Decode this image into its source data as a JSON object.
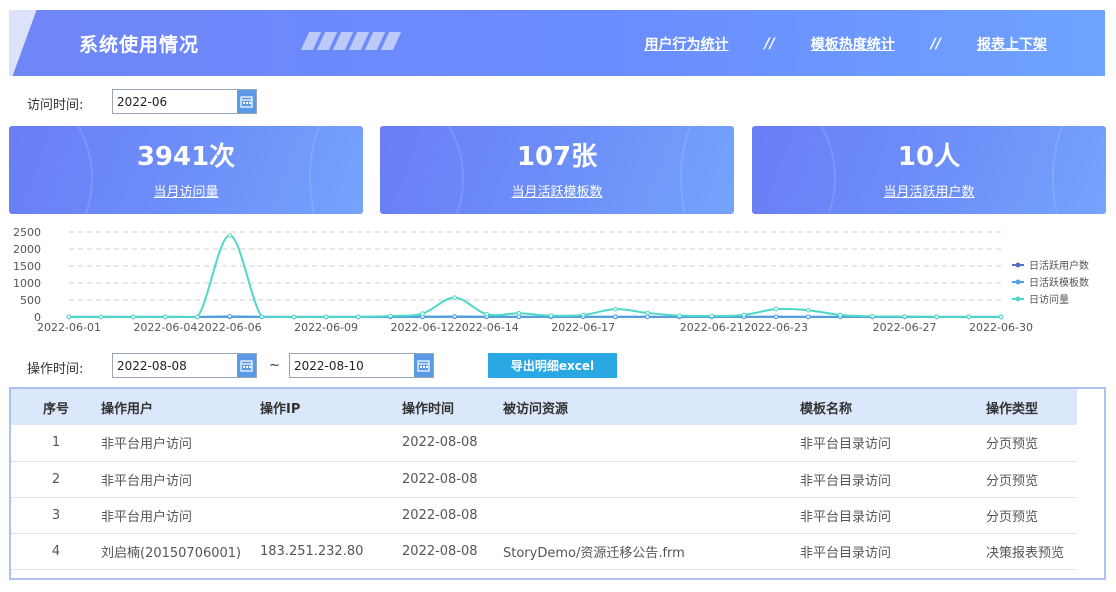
{
  "header": {
    "title": "系统使用情况",
    "nav": [
      {
        "label": "用户行为统计"
      },
      {
        "label": "模板热度统计"
      },
      {
        "label": "报表上下架"
      }
    ],
    "separator": "//"
  },
  "filter_visit": {
    "label": "访问时间:",
    "value": "2022-06"
  },
  "cards": [
    {
      "value": "3941次",
      "label": "当月访问量"
    },
    {
      "value": "107张",
      "label": "当月活跃模板数"
    },
    {
      "value": "10人",
      "label": "当月活跃用户数"
    }
  ],
  "chart_data": {
    "type": "line",
    "x": [
      "2022-06-01",
      "2022-06-02",
      "2022-06-03",
      "2022-06-04",
      "2022-06-05",
      "2022-06-06",
      "2022-06-07",
      "2022-06-08",
      "2022-06-09",
      "2022-06-10",
      "2022-06-11",
      "2022-06-12",
      "2022-06-13",
      "2022-06-14",
      "2022-06-15",
      "2022-06-16",
      "2022-06-17",
      "2022-06-18",
      "2022-06-19",
      "2022-06-20",
      "2022-06-21",
      "2022-06-22",
      "2022-06-23",
      "2022-06-24",
      "2022-06-25",
      "2022-06-26",
      "2022-06-27",
      "2022-06-28",
      "2022-06-29",
      "2022-06-30"
    ],
    "xticks": [
      "2022-06-01",
      "2022-06-04",
      "2022-06-06",
      "2022-06-09",
      "2022-06-12",
      "2022-06-14",
      "2022-06-17",
      "2022-06-21",
      "2022-06-23",
      "2022-06-27",
      "2022-06-30"
    ],
    "yticks": [
      0,
      500,
      1000,
      1500,
      2000,
      2500
    ],
    "ylim": [
      0,
      2500
    ],
    "grid": true,
    "legend_position": "right",
    "series": [
      {
        "name": "日活跃用户数",
        "color": "#5470c6",
        "values": [
          2,
          2,
          2,
          2,
          2,
          5,
          3,
          2,
          2,
          2,
          2,
          3,
          4,
          3,
          3,
          2,
          3,
          3,
          3,
          2,
          2,
          3,
          3,
          3,
          2,
          2,
          2,
          2,
          2,
          2
        ]
      },
      {
        "name": "日活跃模板数",
        "color": "#4ea0e2",
        "values": [
          1,
          1,
          1,
          1,
          1,
          20,
          4,
          1,
          1,
          1,
          5,
          10,
          15,
          10,
          6,
          4,
          6,
          8,
          6,
          4,
          3,
          5,
          8,
          6,
          3,
          2,
          2,
          1,
          1,
          1
        ]
      },
      {
        "name": "日访问量",
        "color": "#4fd8c8",
        "values": [
          5,
          5,
          5,
          5,
          5,
          2400,
          10,
          5,
          5,
          5,
          30,
          100,
          570,
          80,
          110,
          40,
          60,
          230,
          120,
          40,
          30,
          60,
          230,
          200,
          60,
          20,
          15,
          5,
          5,
          5
        ]
      }
    ]
  },
  "filter_op": {
    "label": "操作时间:",
    "start": "2022-08-08",
    "tilde": "~",
    "end": "2022-08-10"
  },
  "export_label": "导出明细excel",
  "table": {
    "columns": [
      "序号",
      "操作用户",
      "操作IP",
      "操作时间",
      "被访问资源",
      "模板名称",
      "操作类型"
    ],
    "rows": [
      [
        "1",
        "非平台用户访问",
        "",
        "2022-08-08",
        "",
        "非平台目录访问",
        "分页预览"
      ],
      [
        "2",
        "非平台用户访问",
        "",
        "2022-08-08",
        "",
        "非平台目录访问",
        "分页预览"
      ],
      [
        "3",
        "非平台用户访问",
        "",
        "2022-08-08",
        "",
        "非平台目录访问",
        "分页预览"
      ],
      [
        "4",
        "刘启楠(20150706001)",
        "183.251.232.80",
        "2022-08-08",
        "StoryDemo/资源迁移公告.frm",
        "非平台目录访问",
        "决策报表预览"
      ]
    ]
  }
}
